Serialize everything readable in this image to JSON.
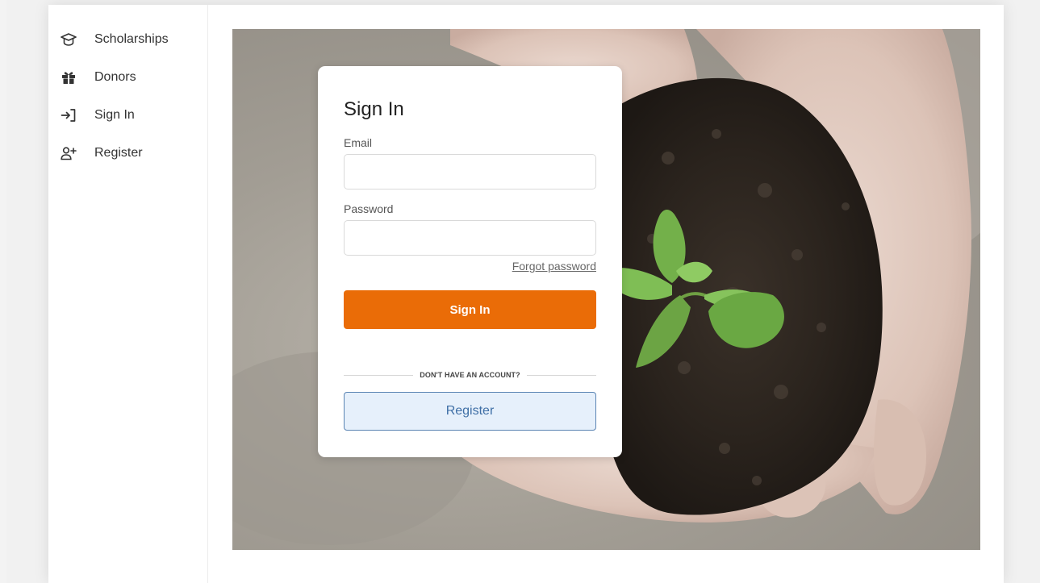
{
  "sidebar": {
    "items": [
      {
        "label": "Scholarships",
        "icon": "graduation-cap-icon"
      },
      {
        "label": "Donors",
        "icon": "gift-icon"
      },
      {
        "label": "Sign In",
        "icon": "sign-in-icon"
      },
      {
        "label": "Register",
        "icon": "add-user-icon"
      }
    ]
  },
  "signin": {
    "title": "Sign In",
    "email_label": "Email",
    "email_value": "",
    "password_label": "Password",
    "password_value": "",
    "forgot_label": "Forgot password",
    "submit_label": "Sign In",
    "divider_text": "DON'T HAVE AN ACCOUNT?",
    "register_label": "Register"
  },
  "colors": {
    "primary": "#ea6c07",
    "secondary_bg": "#e6f0fb",
    "secondary_border": "#5a84b3",
    "secondary_text": "#3f6fa6"
  }
}
